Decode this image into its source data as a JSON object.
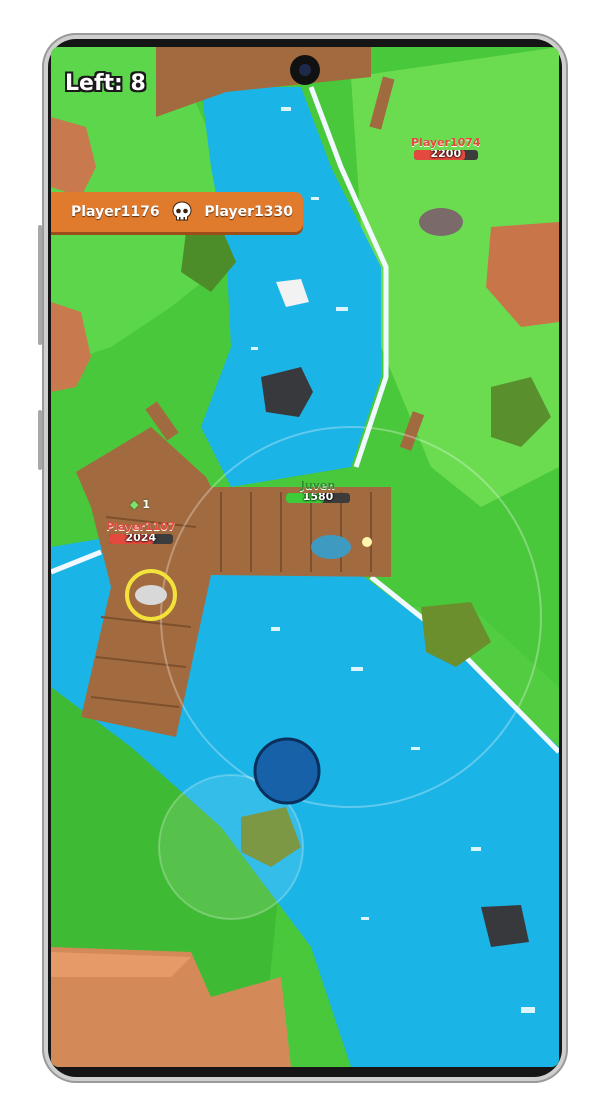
{
  "hud": {
    "left_label": "Left: 8"
  },
  "killfeed": {
    "killer": "Player1176",
    "victim": "Player1330",
    "icon": "skull-icon"
  },
  "players": [
    {
      "name": "Player1074",
      "hp": "2200",
      "hp_fraction": 0.8,
      "team": "enemy"
    },
    {
      "name": "Player1107",
      "hp": "2024",
      "hp_fraction": 0.7,
      "team": "enemy"
    },
    {
      "name": "Juven",
      "hp": "1580",
      "hp_fraction": 0.6,
      "team": "self"
    }
  ],
  "pickup": {
    "gem_count": "1"
  },
  "colors": {
    "grass": "#49c83b",
    "water": "#1ab4e6",
    "wood": "#a26b3f",
    "killfeed": "#e07b2e",
    "enemy_hp": "#e34a3d",
    "self_hp": "#3ecb3a"
  }
}
